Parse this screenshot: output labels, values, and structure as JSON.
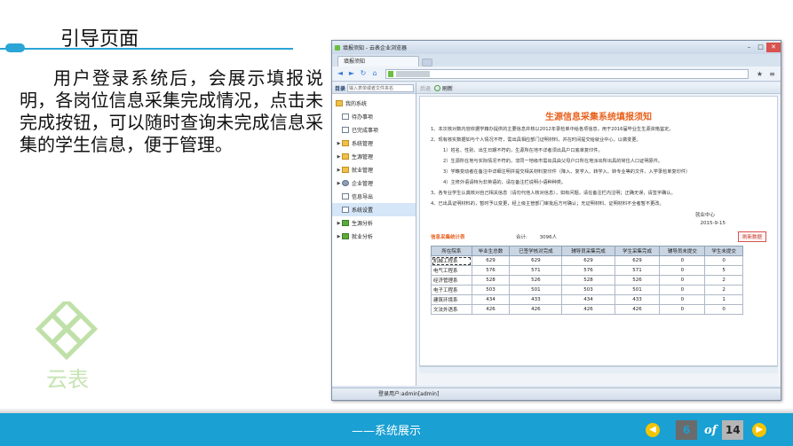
{
  "slide": {
    "title": "引导页面",
    "paragraph": "用户登录系统后，会展示填报说明，各岗位信息采集完成情况，点击未完成按钮，可以随时查询未完成信息采集的学生信息，便于管理。",
    "logo_text": "云表",
    "footer_text": "——系统展示",
    "page_current": "6",
    "page_of": "of",
    "page_total": "14",
    "accent_color": "#1aa0d3"
  },
  "browser": {
    "window_title": "填报须知 - 云表企业浏览器",
    "tab_label": "填报须知",
    "nav_icons": [
      "back-arrow-icon",
      "forward-arrow-icon",
      "refresh-icon",
      "home-icon",
      "star-icon",
      "menu-icon"
    ],
    "status_text": "登录用户:admin[admin]"
  },
  "sidebar": {
    "header_label": "目录",
    "search_placeholder": "输入表单或者文件夹名",
    "items": [
      {
        "label": "我的系统",
        "icon": "folder-icon"
      },
      {
        "label": "待办事项",
        "icon": "page-icon"
      },
      {
        "label": "已完成事项",
        "icon": "page-icon"
      },
      {
        "label": "系统管理",
        "icon": "folder-icon"
      },
      {
        "label": "生源管理",
        "icon": "folder-icon"
      },
      {
        "label": "就业管理",
        "icon": "folder-icon"
      },
      {
        "label": "企业管理",
        "icon": "gear-icon"
      },
      {
        "label": "信息导出",
        "icon": "page-icon"
      },
      {
        "label": "系统设置",
        "icon": "page-icon"
      },
      {
        "label": "生源分析",
        "icon": "chart-icon"
      },
      {
        "label": "就业分析",
        "icon": "chart-icon"
      }
    ]
  },
  "toolbar": {
    "back_label": "后退",
    "refresh_label": "刷新"
  },
  "document": {
    "title": "生源信息采集系统填报须知",
    "paragraphs": [
      "1、本次核对数内容依据学籍办提供的主要信息并核以2012年录检单中给各项信息，用于2016届毕业生生源资格鉴定。",
      "2、现有核实数据如与个人情况不符，需出具相应部门证明材料，并在时间提交给就业中心，以做变更。",
      "1）姓名、性别、出生日期不符的，生源所在地不详者须出具户口底单复印件。",
      "2）生源所在地与实际情况不符的，非同一地级市需出具由父母户口所在地派出所出具的常住人口证明原件。",
      "3）学籍变动者在备注中详细注明并提交相关材料复印件（降入、复学入、转学入、转专业等的文件、入学录检单复印件）",
      "4）主修外语请特为非英语的，请在备注栏说明小语种种类。",
      "3、各专业学生认真核对自己相关信息（请勿代他人核对信息），如有问题，请在备注栏内注明；正确无误，请签字确认。",
      "4、已出具证明材料的，暂时予以变更，经上级主管部门审批后方可确认；无证明材料、证明材料不全者暂不更改。"
    ],
    "signature": "就业中心",
    "date": "2015-9-15"
  },
  "stats": {
    "label": "信息采集统计表",
    "total_label": "合计:",
    "total_value": "3096人",
    "refresh_button": "刷新数据",
    "columns": [
      "所在院系",
      "毕业生总数",
      "已签学核对完成",
      "辅导员采集完成",
      "学生采集完成",
      "辅导员未提交",
      "学生未提交"
    ],
    "rows": [
      [
        "机械工程系",
        "629",
        "629",
        "629",
        "629",
        "0",
        "0"
      ],
      [
        "电气工程系",
        "576",
        "571",
        "576",
        "571",
        "0",
        "5"
      ],
      [
        "经济管理系",
        "528",
        "526",
        "528",
        "526",
        "0",
        "2"
      ],
      [
        "电子工程系",
        "503",
        "501",
        "503",
        "501",
        "0",
        "2"
      ],
      [
        "建筑环境系",
        "434",
        "433",
        "434",
        "433",
        "0",
        "1"
      ],
      [
        "文法外语系",
        "426",
        "426",
        "426",
        "426",
        "0",
        "0"
      ]
    ]
  }
}
